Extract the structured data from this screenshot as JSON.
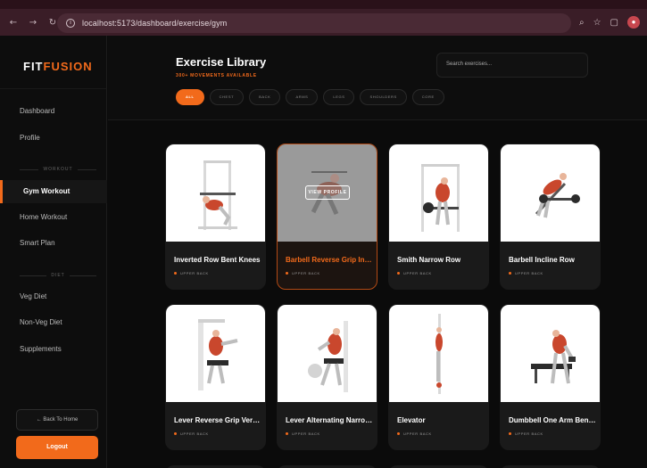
{
  "browser": {
    "url": "localhost:5173/dashboard/exercise/gym"
  },
  "brand": {
    "part1": "FIT",
    "part2": "FUSION"
  },
  "sidebar": {
    "items": [
      {
        "label": "Dashboard"
      },
      {
        "label": "Profile"
      },
      {
        "label": "Gym Workout"
      },
      {
        "label": "Home Workout"
      },
      {
        "label": "Smart Plan"
      },
      {
        "label": "Veg Diet"
      },
      {
        "label": "Non-Veg Diet"
      },
      {
        "label": "Supplements"
      }
    ],
    "sections": {
      "workout": "WORKOUT",
      "diet": "DIET"
    },
    "back_label": "← Back To Home",
    "logout_label": "Logout"
  },
  "header": {
    "title": "Exercise Library",
    "subtitle": "300+ MOVEMENTS AVAILABLE",
    "search_placeholder": "Search exercises...",
    "filters": [
      "ALL",
      "CHEST",
      "BACK",
      "ARMS",
      "LEGS",
      "SHOULDERS",
      "CORE"
    ]
  },
  "exercises": [
    {
      "name": "Inverted Row Bent Knees",
      "tag": "UPPER BACK"
    },
    {
      "name": "Barbell Reverse Grip Inclin...",
      "tag": "UPPER BACK",
      "overlay": "VIEW PROFILE"
    },
    {
      "name": "Smith Narrow Row",
      "tag": "UPPER BACK"
    },
    {
      "name": "Barbell Incline Row",
      "tag": "UPPER BACK"
    },
    {
      "name": "Lever Reverse Grip Vertical...",
      "tag": "UPPER BACK"
    },
    {
      "name": "Lever Alternating Narrow ...",
      "tag": "UPPER BACK"
    },
    {
      "name": "Elevator",
      "tag": "UPPER BACK"
    },
    {
      "name": "Dumbbell One Arm Bent-O...",
      "tag": "UPPER BACK"
    }
  ],
  "colors": {
    "accent": "#f26a1b",
    "background": "#0b0b0b",
    "card": "#1a1a1a"
  }
}
